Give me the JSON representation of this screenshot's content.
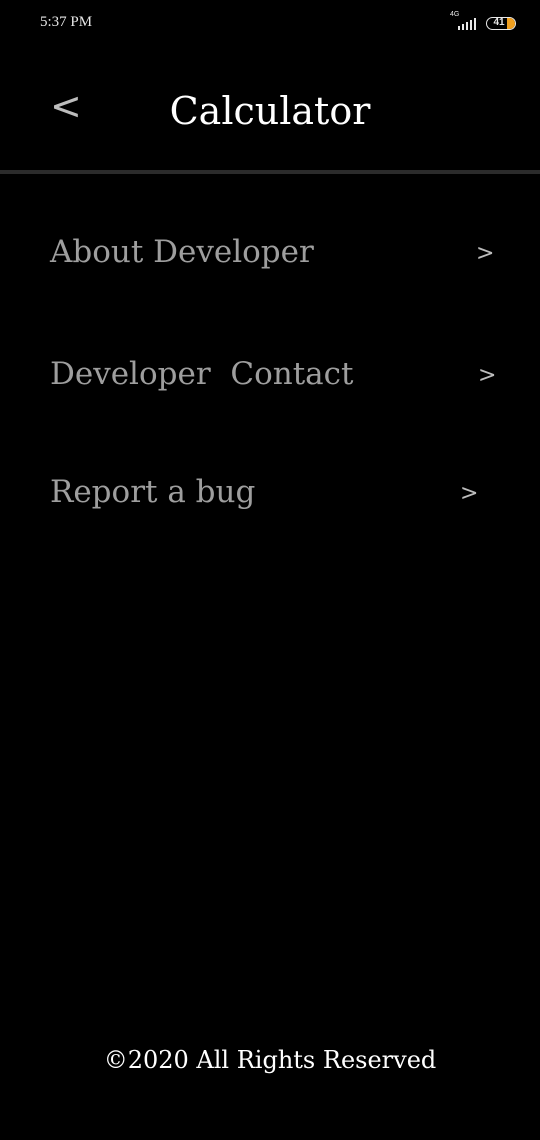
{
  "status_bar": {
    "time": "5:37 PM",
    "network": "4G",
    "battery_level": "41",
    "battery_color": "#f0a020",
    "icons": [
      "signal-icon",
      "battery-icon"
    ]
  },
  "header": {
    "back_label": "<",
    "title": "Calculator"
  },
  "menu": {
    "items": [
      {
        "label": "About Developer",
        "chevron": ">"
      },
      {
        "label": "Developer  Contact",
        "chevron": ">"
      },
      {
        "label": "Report a bug",
        "chevron": ">"
      }
    ]
  },
  "footer": {
    "copyright": "©2020 All Rights Reserved"
  },
  "colors": {
    "background": "#000000",
    "title": "#ffffff",
    "menu_text": "#9e9e9e",
    "divider": "#2b2b2b"
  }
}
